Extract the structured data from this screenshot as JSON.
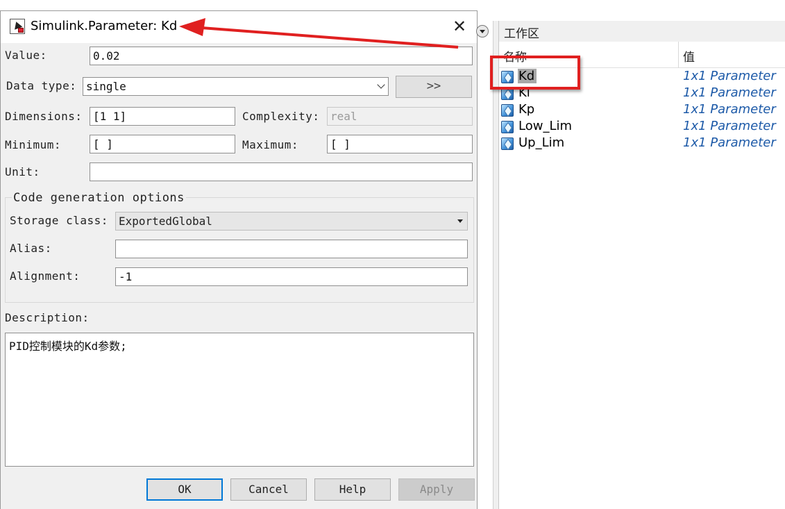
{
  "dialog": {
    "title": "Simulink.Parameter: Kd",
    "value_label": "Value:",
    "value": "0.02",
    "datatype_label": "Data type:",
    "datatype": "single",
    "expand_label": ">>",
    "dimensions_label": "Dimensions:",
    "dimensions": "[1 1]",
    "complexity_label": "Complexity:",
    "complexity": "real",
    "minimum_label": "Minimum:",
    "minimum": "[ ]",
    "maximum_label": "Maximum:",
    "maximum": "[ ]",
    "unit_label": "Unit:",
    "unit": "",
    "codegen": {
      "title": "Code generation options",
      "storage_label": "Storage class:",
      "storage_value": "ExportedGlobal",
      "alias_label": "Alias:",
      "alias": "",
      "alignment_label": "Alignment:",
      "alignment": "-1"
    },
    "description_label": "Description:",
    "description": "PID控制模块的Kd参数;",
    "buttons": {
      "ok": "OK",
      "cancel": "Cancel",
      "help": "Help",
      "apply": "Apply"
    }
  },
  "workspace": {
    "title": "工作区",
    "col_name": "名称",
    "col_value": "值",
    "rows": [
      {
        "name": "Kd",
        "value": "1x1 Parameter",
        "selected": true
      },
      {
        "name": "Ki",
        "value": "1x1 Parameter"
      },
      {
        "name": "Kp",
        "value": "1x1 Parameter"
      },
      {
        "name": "Low_Lim",
        "value": "1x1 Parameter"
      },
      {
        "name": "Up_Lim",
        "value": "1x1 Parameter"
      }
    ]
  },
  "annotation": {
    "color": "#e02020"
  },
  "icons": {
    "title": "simulink-block-icon",
    "close": "close-icon",
    "variable": "parameter-cube-icon",
    "collapse": "collapse-circle-icon"
  }
}
